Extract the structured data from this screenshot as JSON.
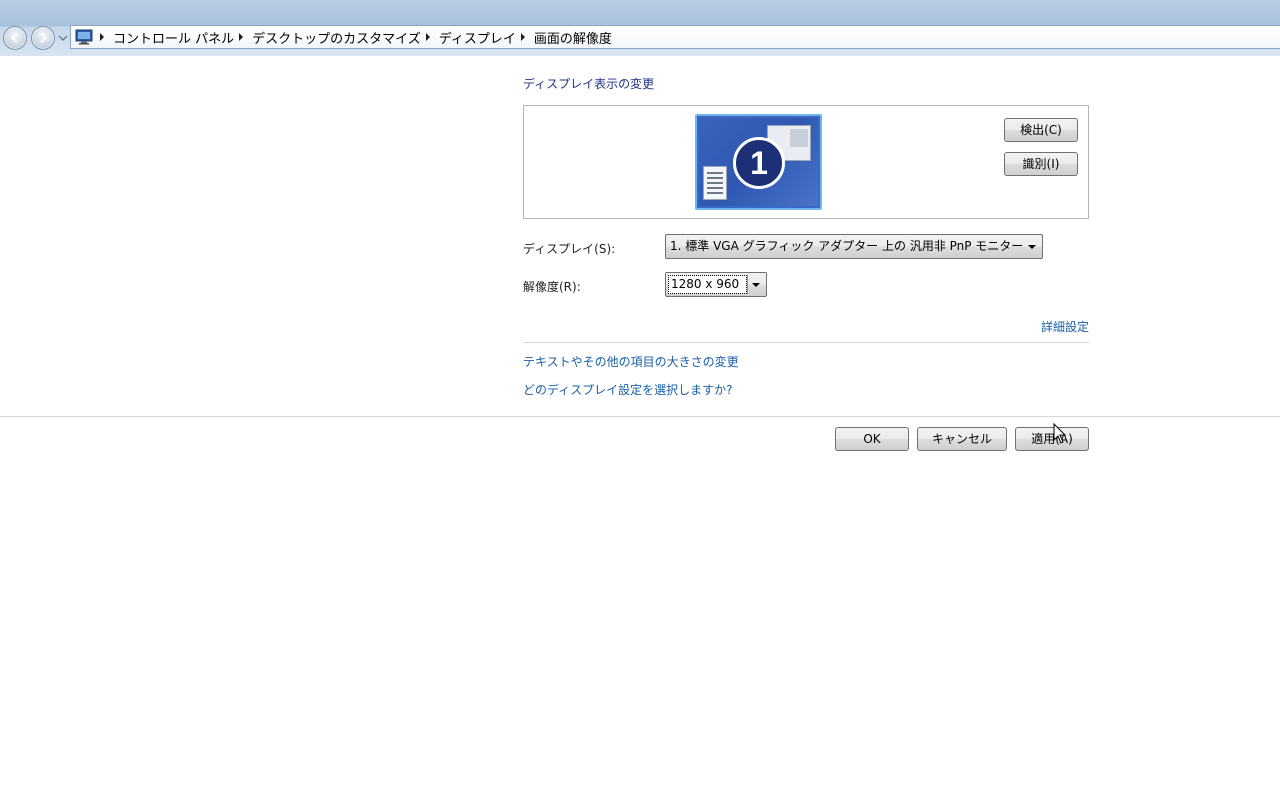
{
  "address_bar": {
    "crumbs": [
      "コントロール パネル",
      "デスクトップのカスタマイズ",
      "ディスプレイ",
      "画面の解像度"
    ]
  },
  "main": {
    "heading": "ディスプレイ表示の変更",
    "monitor_number": "1",
    "detect_button": "検出(C)",
    "identify_button": "識別(I)",
    "display_label": "ディスプレイ(S):",
    "display_value": "1. 標準 VGA グラフィック アダプター 上の 汎用非 PnP モニター",
    "resolution_label": "解像度(R):",
    "resolution_value": "1280 x 960",
    "advanced_link": "詳細設定",
    "text_size_link": "テキストやその他の項目の大きさの変更",
    "which_settings_link": "どのディスプレイ設定を選択しますか?"
  },
  "footer": {
    "ok_button": "OK",
    "cancel_button": "キャンセル",
    "apply_button": "適用(A)"
  }
}
